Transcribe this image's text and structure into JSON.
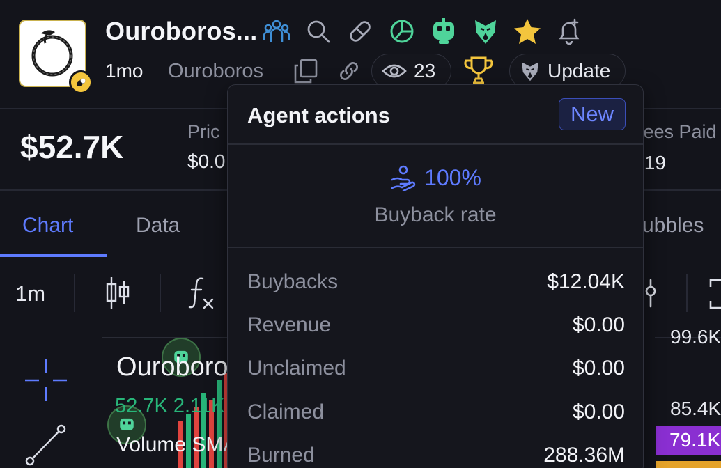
{
  "header": {
    "token_name": "Ouroboros...",
    "age": "1mo",
    "symbol": "Ouroboros",
    "views_count": "23",
    "update_label": "Update"
  },
  "stats": {
    "market_cap": "$52.7K",
    "price_label": "Pric",
    "price_value": "$0.0",
    "fees_label": "Fees Paid",
    "fees_value": ".19"
  },
  "tabs": [
    {
      "label": "Chart",
      "active": true
    },
    {
      "label": "Data",
      "active": false
    },
    {
      "label": "ubbles",
      "active": false
    }
  ],
  "toolbar": {
    "interval": "1m"
  },
  "chart": {
    "title": "Ouroboros",
    "ohlc_1": "52.7K",
    "ohlc_2": "2.11K",
    "volume_label": "Volume SMA",
    "price_levels": [
      "99.6K",
      "85.4K",
      "79.1K"
    ]
  },
  "agent_actions": {
    "title": "Agent actions",
    "badge": "New",
    "buyback_rate_value": "100%",
    "buyback_rate_label": "Buyback rate",
    "rows": [
      {
        "label": "Buybacks",
        "value": "$12.04K"
      },
      {
        "label": "Revenue",
        "value": "$0.00"
      },
      {
        "label": "Unclaimed",
        "value": "$0.00"
      },
      {
        "label": "Claimed",
        "value": "$0.00"
      },
      {
        "label": "Burned",
        "value": "288.36M"
      }
    ]
  },
  "colors": {
    "accent": "#5e7bff",
    "green": "#28b579",
    "gold": "#f3c53d",
    "purple": "#8a2fd1"
  },
  "icons": [
    "users-icon",
    "search-icon",
    "pill-icon",
    "pie-chart-icon",
    "robot-icon",
    "eagle-icon",
    "star-icon",
    "bell-plus-icon",
    "copy-icon",
    "link-icon",
    "eye-icon",
    "trophy-icon",
    "eagle-icon",
    "hand-coins-icon",
    "candles-icon",
    "function-icon",
    "crosshair-icon",
    "trendline-icon",
    "pin-icon",
    "fullscreen-icon"
  ]
}
